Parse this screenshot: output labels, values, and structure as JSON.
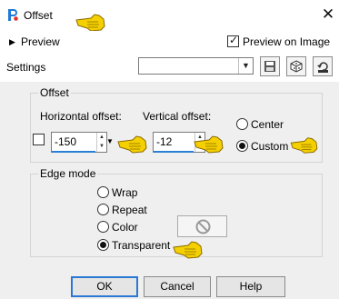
{
  "window": {
    "title": "Offset"
  },
  "header": {
    "preview_label": "Preview",
    "preview_on_image_label": "Preview on Image",
    "preview_on_image_checked": true
  },
  "settings": {
    "label": "Settings",
    "preset_value": "",
    "toolbar_icons": [
      "save-preset-icon",
      "randomize-icon",
      "reset-icon"
    ]
  },
  "offset_group": {
    "title": "Offset",
    "horizontal_label": "Horizontal offset:",
    "horizontal_value": "-150",
    "vertical_label": "Vertical offset:",
    "vertical_value": "-12",
    "link_checked": false,
    "position_options": [
      {
        "label": "Center",
        "selected": false
      },
      {
        "label": "Custom",
        "selected": true
      }
    ]
  },
  "edge_group": {
    "title": "Edge mode",
    "options": [
      {
        "label": "Wrap",
        "selected": false
      },
      {
        "label": "Repeat",
        "selected": false
      },
      {
        "label": "Color",
        "selected": false
      },
      {
        "label": "Transparent",
        "selected": true
      }
    ]
  },
  "buttons": {
    "ok": "OK",
    "cancel": "Cancel",
    "help": "Help"
  },
  "colors": {
    "panel_bg": "#efefef",
    "accent_blue": "#2a7fd4",
    "hand_pointer": "#f5d000"
  }
}
